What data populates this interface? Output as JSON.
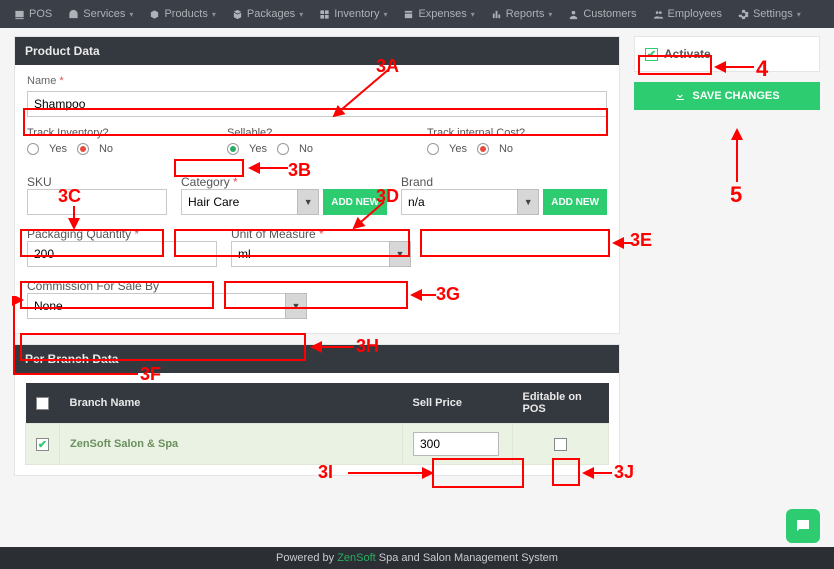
{
  "nav": {
    "items": [
      {
        "label": "POS",
        "caret": false
      },
      {
        "label": "Services",
        "caret": true
      },
      {
        "label": "Products",
        "caret": true
      },
      {
        "label": "Packages",
        "caret": true
      },
      {
        "label": "Inventory",
        "caret": true
      },
      {
        "label": "Expenses",
        "caret": true
      },
      {
        "label": "Reports",
        "caret": true
      },
      {
        "label": "Customers",
        "caret": false
      },
      {
        "label": "Employees",
        "caret": false
      },
      {
        "label": "Settings",
        "caret": true
      }
    ]
  },
  "panels": {
    "product_data": "Product Data",
    "per_branch": "Per Branch Data"
  },
  "fields": {
    "name_label": "Name",
    "name_value": "Shampoo",
    "track_inv_label": "Track Inventory?",
    "sellable_label": "Sellable?",
    "track_cost_label": "Track internal Cost?",
    "yes": "Yes",
    "no": "No",
    "sku_label": "SKU",
    "sku_value": "",
    "category_label": "Category",
    "category_value": "Hair Care",
    "brand_label": "Brand",
    "brand_value": "n/a",
    "add_new": "ADD NEW",
    "pack_qty_label": "Packaging Quantity",
    "pack_qty_value": "200",
    "uom_label": "Unit of Measure",
    "uom_value": "ml",
    "commission_label": "Commission For Sale By",
    "commission_value": "None"
  },
  "side": {
    "activate": "Activate",
    "save": "SAVE CHANGES"
  },
  "table": {
    "cols": {
      "branch": "Branch Name",
      "price": "Sell Price",
      "editable": "Editable on POS"
    },
    "row": {
      "branch": "ZenSoft Salon & Spa",
      "price": "300"
    }
  },
  "footer": {
    "pre": "Powered by ",
    "brand": "ZenSoft",
    "post": " Spa and Salon Management System"
  },
  "annotations": {
    "a3a": "3A",
    "a3b": "3B",
    "a3c": "3C",
    "a3d": "3D",
    "a3e": "3E",
    "a3f": "3F",
    "a3g": "3G",
    "a3h": "3H",
    "a3i": "3I",
    "a3j": "3J",
    "a4": "4",
    "a5": "5"
  }
}
